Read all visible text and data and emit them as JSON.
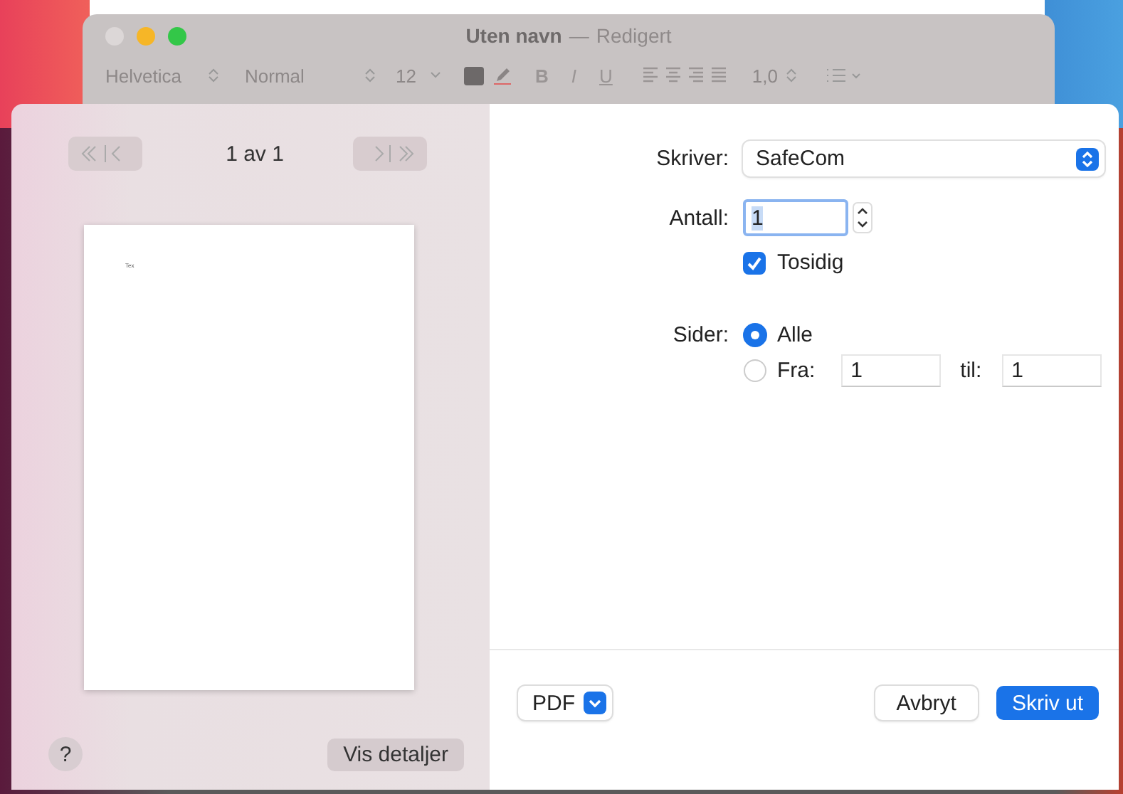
{
  "window": {
    "title": "Uten navn",
    "separator": "—",
    "subtitle": "Redigert"
  },
  "toolbar": {
    "font": "Helvetica",
    "style": "Normal",
    "size": "12",
    "bold": "B",
    "italic": "I",
    "underline": "U",
    "spacing": "1,0"
  },
  "preview": {
    "page_label": "1 av 1",
    "page_text": "Tex"
  },
  "printer": {
    "label": "Skriver:",
    "value": "SafeCom"
  },
  "copies": {
    "label": "Antall:",
    "value": "1"
  },
  "duplex": {
    "label": "Tosidig",
    "checked": true
  },
  "pages": {
    "label": "Sider:",
    "options": [
      {
        "label": "Alle",
        "selected": true
      },
      {
        "label": "Fra:",
        "selected": false
      }
    ],
    "from": "1",
    "to_label": "til:",
    "to": "1"
  },
  "buttons": {
    "help": "?",
    "details": "Vis detaljer",
    "pdf": "PDF",
    "cancel": "Avbryt",
    "print": "Skriv ut"
  }
}
